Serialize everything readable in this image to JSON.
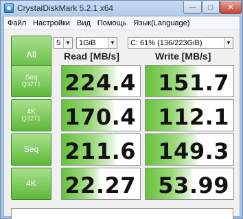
{
  "window": {
    "title": "CrystalDiskMark 5.2.1 x64",
    "minimize_glyph": "—",
    "maximize_glyph": "□",
    "close_glyph": "✕"
  },
  "menu": {
    "items": [
      "Файл",
      "Настройки",
      "Вид",
      "Помощь",
      "Язык(Language)"
    ]
  },
  "controls": {
    "all_button_label": "All",
    "test_count": "5",
    "test_size": "1GiB",
    "drive": "C: 61% (136/223GiB)",
    "dropdown_arrow": "▼"
  },
  "headers": {
    "read": "Read [MB/s]",
    "write": "Write [MB/s]"
  },
  "tests": [
    {
      "label_line1": "Seq",
      "label_line2": "Q32T1",
      "read": "224.4",
      "write": "151.7",
      "read_level": 0.72,
      "write_level": 0.62
    },
    {
      "label_line1": "4K",
      "label_line2": "Q32T1",
      "read": "170.4",
      "write": "112.1",
      "read_level": 0.68,
      "write_level": 0.58
    },
    {
      "label_line1": "Seq",
      "label_line2": "",
      "read": "211.6",
      "write": "149.3",
      "read_level": 0.71,
      "write_level": 0.61
    },
    {
      "label_line1": "4K",
      "label_line2": "",
      "read": "22.27",
      "write": "53.99",
      "read_level": 0.5,
      "write_level": 0.55
    }
  ],
  "comment": ""
}
